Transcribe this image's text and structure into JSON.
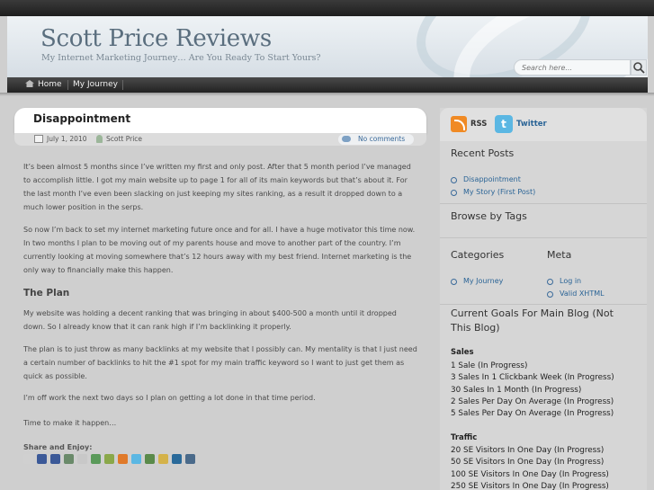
{
  "site": {
    "title": "Scott Price Reviews",
    "tagline": "My Internet Marketing Journey… Are You Ready To Start Yours?",
    "search_placeholder": "Search here..."
  },
  "nav": {
    "home": "Home",
    "journey": "My Journey"
  },
  "post": {
    "title": "Disappointment",
    "date": "July 1, 2010",
    "author": "Scott Price",
    "comments": "No comments",
    "p1": "It’s been almost 5 months since I’ve written my first and only post.  After that 5 month period I’ve managed to accomplish little.  I got my main website up to page 1 for all of its main keywords but that’s about it.  For the last month I’ve even been slacking on just keeping my sites ranking, as a result it dropped down to a much lower position in the serps.",
    "p2": "So now I’m back to set my internet marketing future once and for all.  I have a huge motivator this time now.  In two months I plan to be moving out of my parents house and move to another part of the country.  I’m currently looking at moving somewhere that’s 12 hours away with my best friend.  Internet marketing is the only way to financially make this happen.",
    "plan_heading": "The Plan",
    "p3": "My website was holding a decent ranking that was bringing in about $400-500 a month until it dropped down.  So I already know that it can rank high if I’m backlinking it properly.",
    "p4": "The plan is to just throw as many backlinks at my website that I possibly can.  My mentality is that I just need a certain number of backlinks to hit the #1 spot for my main traffic keyword so I want to just get them as quick as possible.",
    "p5": "I’m off work the next two days so I plan on getting a lot done in that time period.",
    "p6": "Time to make it happen…",
    "share_label": "Share and Enjoy:"
  },
  "share_icons": [
    "email-icon",
    "delicious-icon",
    "facebook-icon",
    "digg-icon",
    "reddit-icon",
    "stumbleupon-icon",
    "google-icon",
    "blogger-icon",
    "twitter-icon",
    "technorati-icon",
    "favorites-icon",
    "linkedin-icon",
    "myspace-icon"
  ],
  "share_colors": [
    "#d0d0d0",
    "#3b5998",
    "#3b5998",
    "#6a8a6a",
    "#c8c8c8",
    "#5a9a5a",
    "#8aa84a",
    "#e07a2a",
    "#5bb7e3",
    "#5a8a4a",
    "#d4b24a",
    "#2a6a9a",
    "#4a6a8a"
  ],
  "sidebar": {
    "rss": "RSS",
    "twitter": "Twitter",
    "twitter_glyph": "t",
    "recent_posts_title": "Recent Posts",
    "recent_posts": [
      "Disappointment",
      "My Story (First Post)"
    ],
    "browse_tags_title": "Browse by Tags",
    "categories_title": "Categories",
    "categories": [
      "My Journey"
    ],
    "meta_title": "Meta",
    "meta_links": [
      "Log in",
      "Valid XHTML"
    ],
    "goals_title": "Current Goals For Main Blog (Not This Blog)",
    "sales_heading": "Sales",
    "sales_goals": [
      "1 Sale (In Progress)",
      "3 Sales In 1 Clickbank Week (In Progress)",
      "30 Sales In 1 Month (In Progress)",
      "2 Sales Per Day On Average (In Progress)",
      "5 Sales Per Day On Average (In Progress)"
    ],
    "traffic_heading": "Traffic",
    "traffic_goals": [
      "20 SE Visitors In One Day (In Progress)",
      "50 SE Visitors In One Day (In Progress)",
      "100 SE Visitors In One Day (In Progress)",
      "250 SE Visitors In One Day (In Progress)"
    ]
  }
}
